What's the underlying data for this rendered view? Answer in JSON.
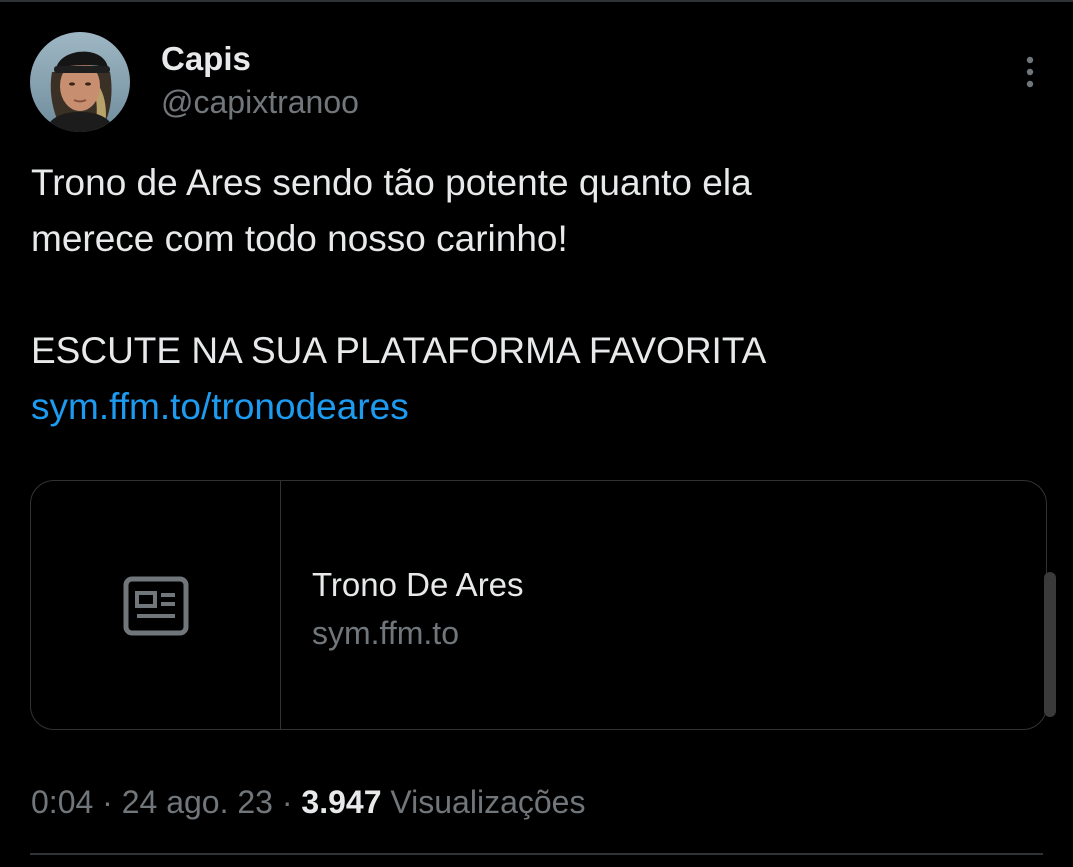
{
  "author": {
    "display_name": "Capis",
    "handle": "@capixtranoo",
    "avatar_icon": "profile-photo"
  },
  "tweet": {
    "line1": "Trono de Ares sendo tão potente quanto ela",
    "line2": "merece com todo nosso carinho!",
    "line3": "ESCUTE NA SUA PLATAFORMA FAVORITA",
    "link": "sym.ffm.to/tronodeares"
  },
  "card": {
    "icon": "article-icon",
    "title": "Trono De Ares",
    "domain": "sym.ffm.to"
  },
  "meta": {
    "time": "0:04",
    "separator": "·",
    "date": "24 ago. 23",
    "views_count": "3.947",
    "views_label": "Visualizações"
  },
  "colors": {
    "background": "#000000",
    "text_primary": "#e7e9ea",
    "text_secondary": "#71767b",
    "link": "#1d9bf0",
    "border": "#2f3336"
  }
}
